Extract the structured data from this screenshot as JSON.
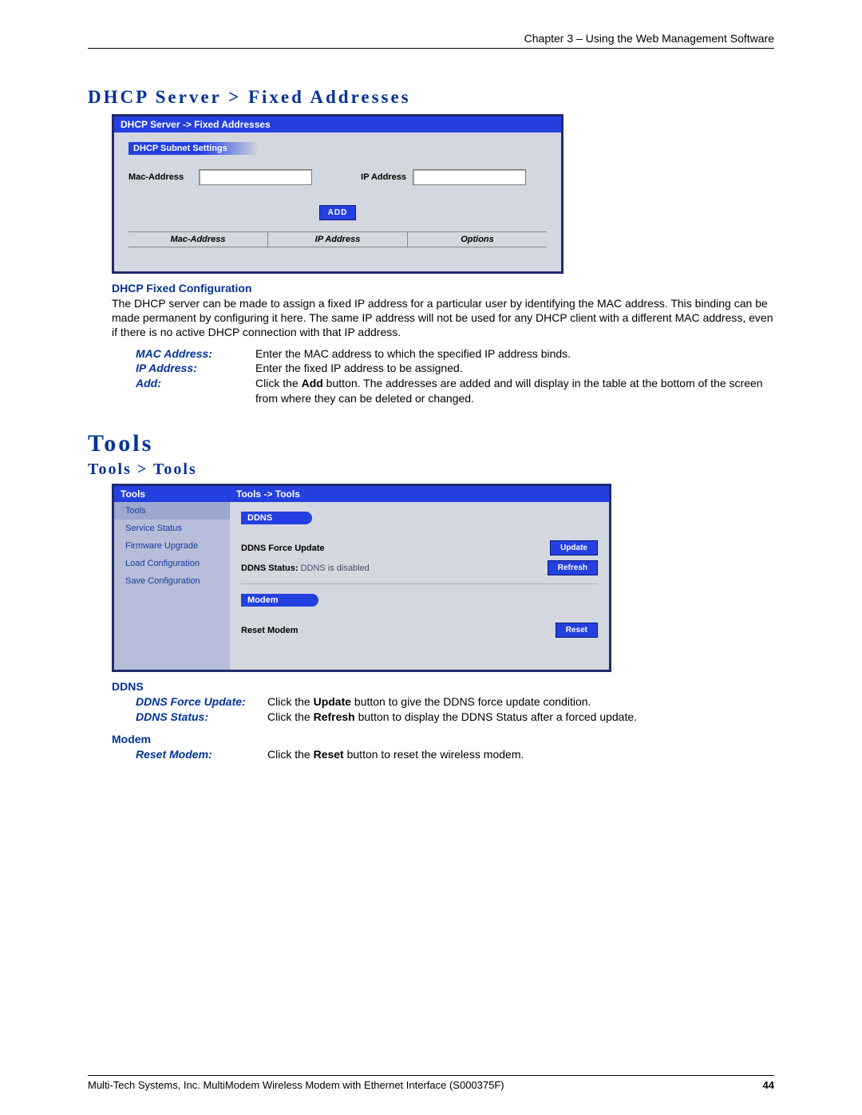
{
  "header": {
    "breadcrumb": "Chapter 3 – Using the Web Management Software"
  },
  "dhcp": {
    "title": "DHCP Server > Fixed Addresses",
    "panel_title": "DHCP Server -> Fixed Addresses",
    "subtitle": "DHCP Subnet Settings",
    "mac_label": "Mac-Address",
    "ip_label": "IP Address",
    "add_btn": "ADD",
    "col_mac": "Mac-Address",
    "col_ip": "IP Address",
    "col_opt": "Options",
    "explain_title": "DHCP Fixed Configuration",
    "explain_body": "The DHCP server can be made to assign a fixed IP address for a particular user by identifying the MAC address. This binding can be made permanent by configuring it here. The same IP address will not be used for any DHCP client with a different MAC address, even if there is no active DHCP connection with that IP address.",
    "fields": {
      "mac": {
        "label": "MAC Address:",
        "text": "Enter the MAC address to which the specified IP address binds."
      },
      "ip": {
        "label": "IP Address:",
        "text": "Enter the fixed IP address to be assigned."
      },
      "add": {
        "label": "Add:",
        "text_pre": "Click the ",
        "text_bold": "Add",
        "text_post": " button. The addresses are added and will display in the table at the bottom of the screen from where they can be deleted or changed."
      }
    }
  },
  "tools": {
    "big_title": "Tools",
    "sub_title": "Tools > Tools",
    "side_title": "Tools",
    "side_items": [
      "Tools",
      "Service Status",
      "Firmware Upgrade",
      "Load Configuration",
      "Save Configuration"
    ],
    "main_bar": "Tools -> Tools",
    "ddns": {
      "pill": "DDNS",
      "force_label": "DDNS Force Update",
      "update_btn": "Update",
      "status_label": "DDNS Status:",
      "status_value": "DDNS is disabled",
      "refresh_btn": "Refresh"
    },
    "modem": {
      "pill": "Modem",
      "reset_label": "Reset Modem",
      "reset_btn": "Reset"
    }
  },
  "explain2": {
    "ddns_title": "DDNS",
    "force": {
      "label": "DDNS Force Update:",
      "pre": "Click the ",
      "bold": "Update",
      "post": " button to give the DDNS force update condition."
    },
    "status": {
      "label": "DDNS Status:",
      "pre": "Click the ",
      "bold": "Refresh",
      "post": " button to display the DDNS Status after a forced update."
    },
    "modem_title": "Modem",
    "reset": {
      "label": "Reset Modem:",
      "pre": "Click the ",
      "bold": "Reset",
      "post": " button to reset the wireless modem."
    }
  },
  "footer": {
    "left": "Multi-Tech Systems, Inc. MultiModem Wireless Modem with Ethernet Interface (S000375F)",
    "page": "44"
  }
}
